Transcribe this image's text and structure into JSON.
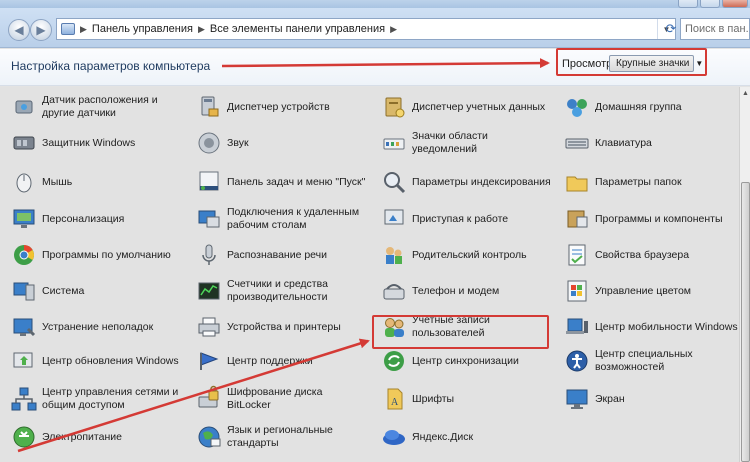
{
  "window": {
    "breadcrumbs": [
      "Панель управления",
      "Все элементы панели управления"
    ],
    "search_placeholder": "Поиск в пан..."
  },
  "header": {
    "title": "Настройка параметров компьютера",
    "view_label": "Просмотр:",
    "view_value": "Крупные значки"
  },
  "items": [
    {
      "label": "Датчик расположения и другие датчики",
      "icon": "location-sensor-icon"
    },
    {
      "label": "Диспетчер устройств",
      "icon": "device-manager-icon"
    },
    {
      "label": "Диспетчер учетных данных",
      "icon": "credential-manager-icon"
    },
    {
      "label": "Домашняя группа",
      "icon": "homegroup-icon"
    },
    {
      "label": "Защитник Windows",
      "icon": "windows-defender-icon"
    },
    {
      "label": "Звук",
      "icon": "sound-icon"
    },
    {
      "label": "Значки области уведомлений",
      "icon": "notification-icons-icon"
    },
    {
      "label": "Клавиатура",
      "icon": "keyboard-icon"
    },
    {
      "label": "Мышь",
      "icon": "mouse-icon"
    },
    {
      "label": "Панель задач и меню \"Пуск\"",
      "icon": "taskbar-icon"
    },
    {
      "label": "Параметры индексирования",
      "icon": "indexing-icon"
    },
    {
      "label": "Параметры папок",
      "icon": "folder-options-icon"
    },
    {
      "label": "Персонализация",
      "icon": "personalization-icon"
    },
    {
      "label": "Подключения к удаленным рабочим столам",
      "icon": "remote-desktop-icon"
    },
    {
      "label": "Приступая к работе",
      "icon": "getting-started-icon"
    },
    {
      "label": "Программы и компоненты",
      "icon": "programs-features-icon"
    },
    {
      "label": "Программы по умолчанию",
      "icon": "default-programs-icon"
    },
    {
      "label": "Распознавание речи",
      "icon": "speech-recognition-icon"
    },
    {
      "label": "Родительский контроль",
      "icon": "parental-controls-icon"
    },
    {
      "label": "Свойства браузера",
      "icon": "internet-options-icon"
    },
    {
      "label": "Система",
      "icon": "system-icon"
    },
    {
      "label": "Счетчики и средства производительности",
      "icon": "performance-icon"
    },
    {
      "label": "Телефон и модем",
      "icon": "phone-modem-icon"
    },
    {
      "label": "Управление цветом",
      "icon": "color-management-icon"
    },
    {
      "label": "Устранение неполадок",
      "icon": "troubleshooting-icon"
    },
    {
      "label": "Устройства и принтеры",
      "icon": "devices-printers-icon"
    },
    {
      "label": "Учетные записи пользователей",
      "icon": "user-accounts-icon"
    },
    {
      "label": "Центр мобильности Windows",
      "icon": "mobility-center-icon"
    },
    {
      "label": "Центр обновления Windows",
      "icon": "windows-update-icon"
    },
    {
      "label": "Центр поддержки",
      "icon": "action-center-icon"
    },
    {
      "label": "Центр синхронизации",
      "icon": "sync-center-icon"
    },
    {
      "label": "Центр специальных возможностей",
      "icon": "ease-of-access-icon"
    },
    {
      "label": "Центр управления сетями и общим доступом",
      "icon": "network-center-icon"
    },
    {
      "label": "Шифрование диска BitLocker",
      "icon": "bitlocker-icon"
    },
    {
      "label": "Шрифты",
      "icon": "fonts-icon"
    },
    {
      "label": "Экран",
      "icon": "display-icon"
    },
    {
      "label": "Электропитание",
      "icon": "power-options-icon"
    },
    {
      "label": "Язык и региональные стандарты",
      "icon": "region-language-icon"
    },
    {
      "label": "Яндекс.Диск",
      "icon": "yandex-disk-icon"
    }
  ],
  "colors": {
    "annotation_red": "#d43a35",
    "background": "#e2e2e2"
  }
}
